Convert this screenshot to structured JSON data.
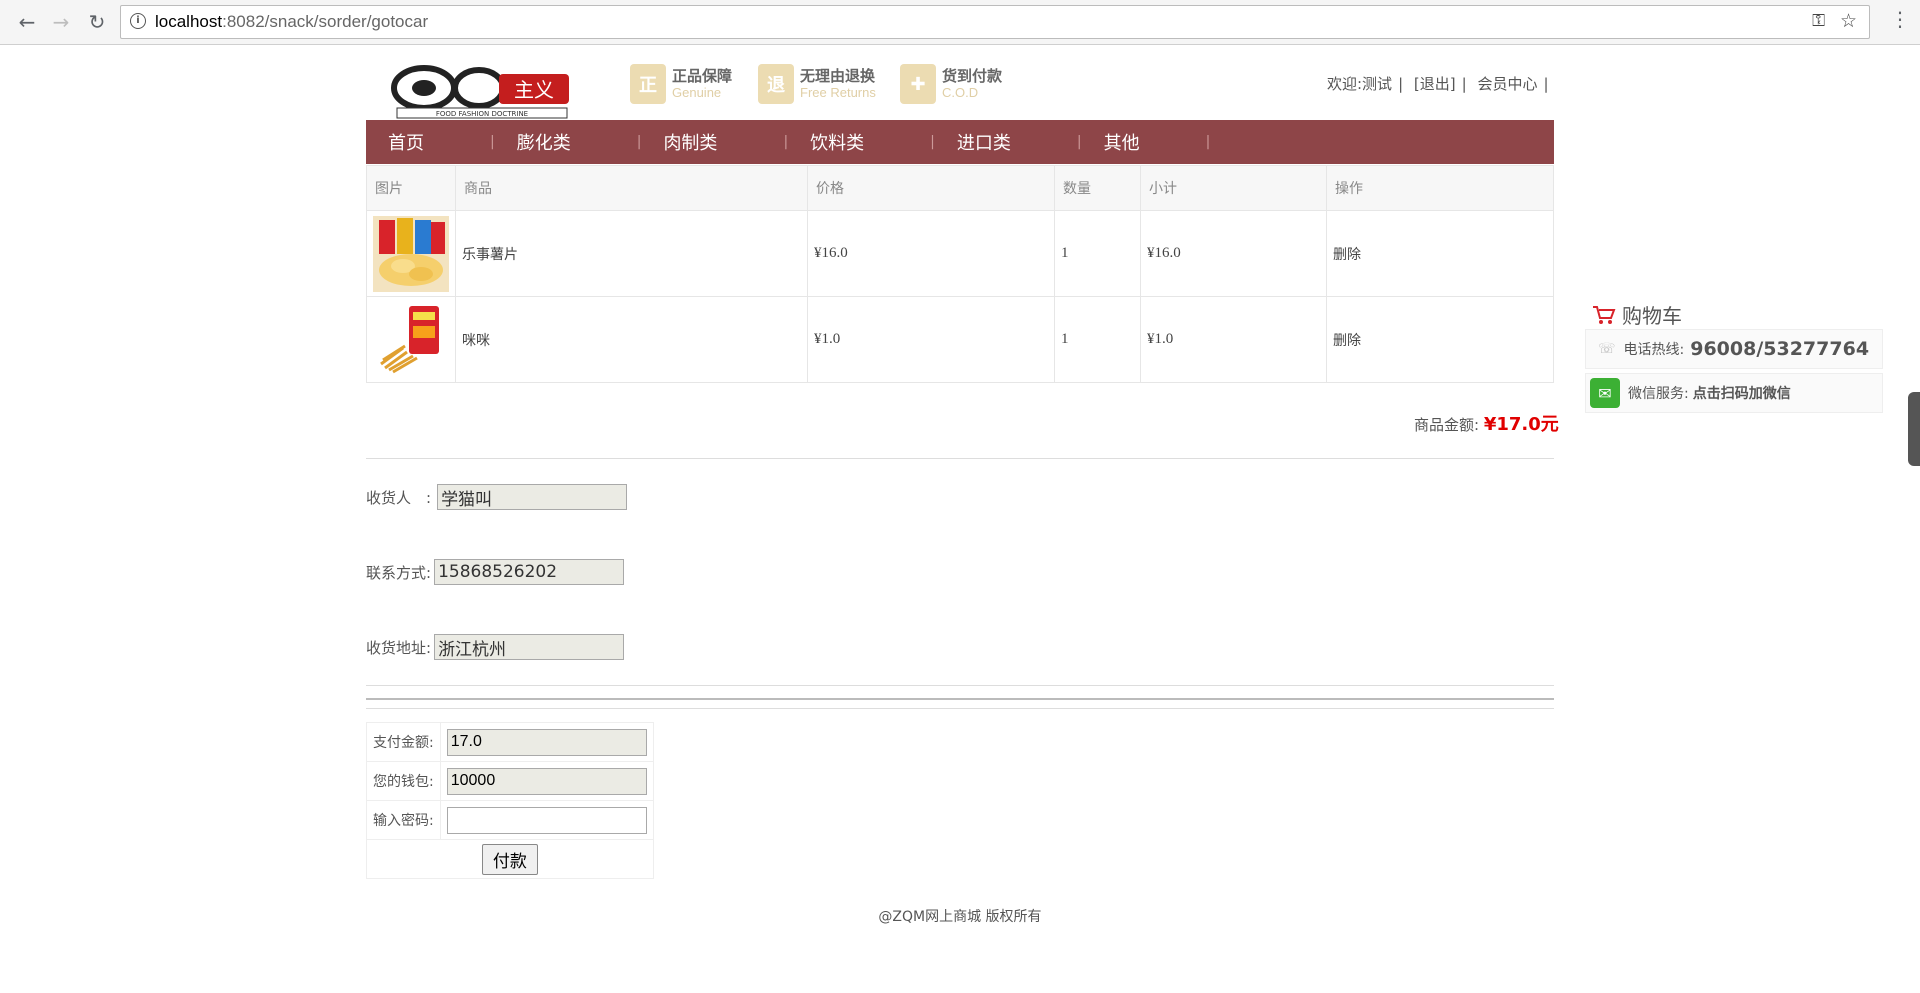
{
  "browser": {
    "url_host": "localhost",
    "url_path": ":8082/snack/sorder/gotocar"
  },
  "header": {
    "logo_text": "FOOD FASHION DOCTRINE",
    "badges": [
      {
        "title": "正品保障",
        "subtitle": "Genuine",
        "glyph": "正"
      },
      {
        "title": "无理由退换",
        "subtitle": "Free Returns",
        "glyph": "退"
      },
      {
        "title": "货到付款",
        "subtitle": "C.O.D",
        "glyph": "✚"
      }
    ],
    "welcome": "欢迎:测试",
    "logout": "[退出]",
    "member_center": "会员中心"
  },
  "nav": [
    "首页",
    "膨化类",
    "肉制类",
    "饮料类",
    "进口类",
    "其他"
  ],
  "cart": {
    "headers": [
      "图片",
      "商品",
      "价格",
      "数量",
      "小计",
      "操作"
    ],
    "rows": [
      {
        "name": "乐事薯片",
        "price": "¥16.0",
        "qty": "1",
        "subtotal": "¥16.0",
        "action": "删除"
      },
      {
        "name": "咪咪",
        "price": "¥1.0",
        "qty": "1",
        "subtotal": "¥1.0",
        "action": "删除"
      }
    ],
    "total_label": "商品金额:",
    "total_value": "¥17.0元"
  },
  "order": {
    "receiver_label": "收货人　:",
    "receiver_value": "学猫叫",
    "phone_label": "联系方式:",
    "phone_value": "15868526202",
    "address_label": "收货地址:",
    "address_value": "浙江杭州"
  },
  "payment": {
    "amount_label": "支付金额:",
    "amount_value": "17.0",
    "wallet_label": "您的钱包:",
    "wallet_value": "10000",
    "password_label": "输入密码:",
    "password_value": "",
    "pay_button": "付款"
  },
  "footer": "@ZQM网上商城 版权所有",
  "side": {
    "cart_title": "购物车",
    "hotline_label": "电话热线:",
    "hotline_value": "96008/53277764",
    "wechat_label": "微信服务:",
    "wechat_value": "点击扫码加微信"
  },
  "colors": {
    "nav_bg": "#8e4548",
    "total_red": "#e00000"
  }
}
